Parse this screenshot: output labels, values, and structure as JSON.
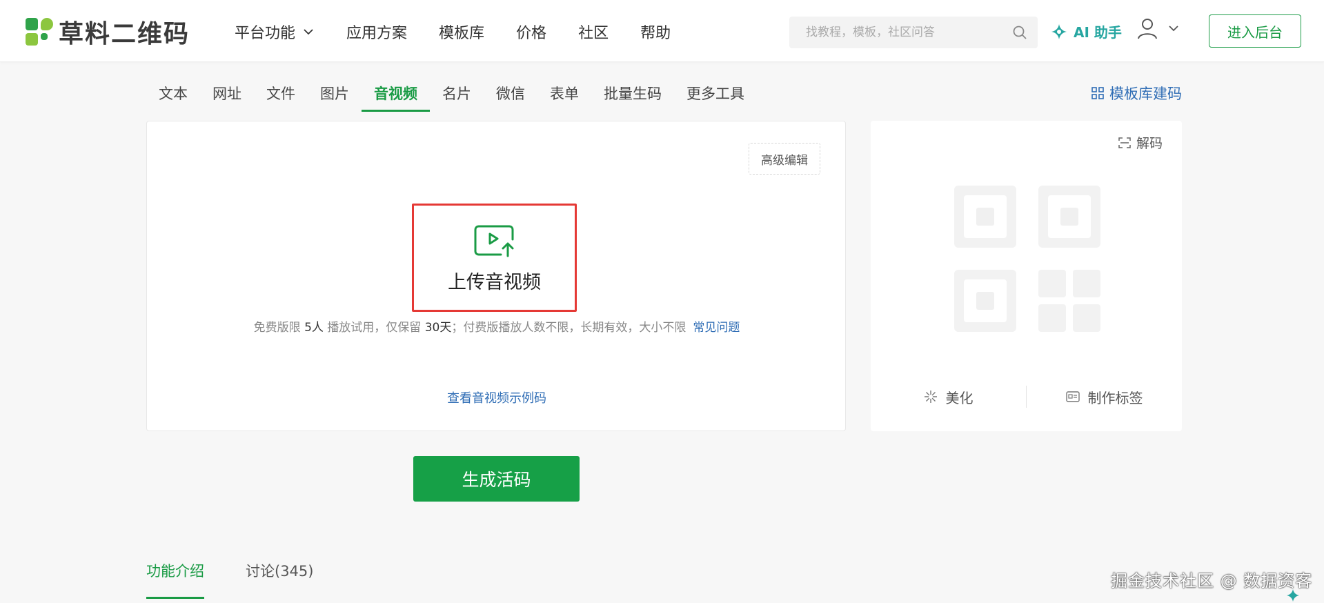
{
  "header": {
    "logo_text": "草料二维码",
    "nav": [
      {
        "label": "平台功能",
        "has_dropdown": true
      },
      {
        "label": "应用方案"
      },
      {
        "label": "模板库"
      },
      {
        "label": "价格"
      },
      {
        "label": "社区"
      },
      {
        "label": "帮助"
      }
    ],
    "search_placeholder": "找教程，模板，社区问答",
    "ai_label": "AI 助手",
    "enter_label": "进入后台"
  },
  "subtabs": {
    "items": [
      "文本",
      "网址",
      "文件",
      "图片",
      "音视频",
      "名片",
      "微信",
      "表单",
      "批量生码",
      "更多工具"
    ],
    "active": "音视频",
    "template_link": "模板库建码"
  },
  "main": {
    "advanced_edit": "高级编辑",
    "upload_label": "上传音视频",
    "notice": {
      "part1": "免费版限 ",
      "people": "5人",
      "part2": " 播放试用，仅保留 ",
      "days": "30天",
      "part3": "；付费版播放人数不限，长期有效，大小不限",
      "faq": "常见问题"
    },
    "example_link": "查看音视频示例码"
  },
  "preview": {
    "decode": "解码",
    "beautify": "美化",
    "make_label": "制作标签"
  },
  "generate_button": "生成活码",
  "bottom_tabs": {
    "items": [
      "功能介绍",
      "讨论(345)"
    ],
    "active": "功能介绍"
  },
  "watermark": "掘金技术社区 @ 数据资客",
  "colors": {
    "brand_green": "#1a9b45",
    "link_blue": "#2f6db5",
    "highlight_red": "#e53935",
    "ai_teal": "#26a6a1"
  }
}
